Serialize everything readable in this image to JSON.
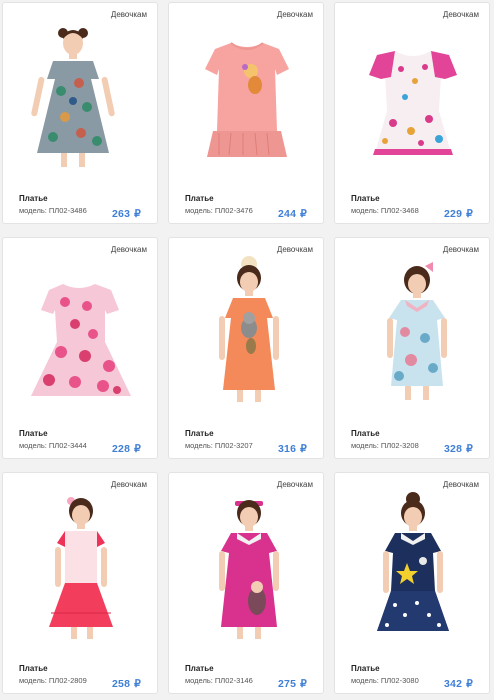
{
  "products": [
    {
      "category": "Девочкам",
      "name": "Платье",
      "model": "модель: ПЛ02-3486",
      "price": "263",
      "currency": "₽",
      "colors": {
        "main": "#8a9aa4",
        "accent": "#3a8c6e",
        "trim": "#e2d9c8"
      }
    },
    {
      "category": "Девочкам",
      "name": "Платье",
      "model": "модель: ПЛ02-3476",
      "price": "244",
      "currency": "₽",
      "colors": {
        "main": "#f7a3a0",
        "accent": "#f28a86",
        "trim": "#ee9691"
      }
    },
    {
      "category": "Девочкам",
      "name": "Платье",
      "model": "модель: ПЛ02-3468",
      "price": "229",
      "currency": "₽",
      "colors": {
        "main": "#f7eef2",
        "accent": "#d93b8a",
        "trim": "#e24597"
      }
    },
    {
      "category": "Девочкам",
      "name": "Платье",
      "model": "модель: ПЛ02-3444",
      "price": "228",
      "currency": "₽",
      "colors": {
        "main": "#f6c7d6",
        "accent": "#e8538a",
        "trim": "#f3b6c9"
      }
    },
    {
      "category": "Девочкам",
      "name": "Платье",
      "model": "модель: ПЛ02-3207",
      "price": "316",
      "currency": "₽",
      "colors": {
        "main": "#f48a5a",
        "accent": "#9a7a4a",
        "trim": "#f07a48"
      }
    },
    {
      "category": "Девочкам",
      "name": "Платье",
      "model": "модель: ПЛ02-3208",
      "price": "328",
      "currency": "₽",
      "colors": {
        "main": "#c9e3ee",
        "accent": "#e28aa0",
        "trim": "#f0b3c3"
      }
    },
    {
      "category": "Девочкам",
      "name": "Платье",
      "model": "модель: ПЛ02-2809",
      "price": "258",
      "currency": "₽",
      "colors": {
        "main": "#fbe0e6",
        "accent": "#f23d5c",
        "trim": "#ef3358"
      }
    },
    {
      "category": "Девочкам",
      "name": "Платье",
      "model": "модель: ПЛ02-3146",
      "price": "275",
      "currency": "₽",
      "colors": {
        "main": "#d9318e",
        "accent": "#f1f1f1",
        "trim": "#c9287f"
      }
    },
    {
      "category": "Девочкам",
      "name": "Платье",
      "model": "модель: ПЛ02-3080",
      "price": "342",
      "currency": "₽",
      "colors": {
        "main": "#1d2f5c",
        "accent": "#f2d12e",
        "trim": "#233a70"
      }
    }
  ],
  "theme": {
    "price_color": "#3f7fd6",
    "skin": "#f2cdb3",
    "hair": "#4a2a1a"
  }
}
